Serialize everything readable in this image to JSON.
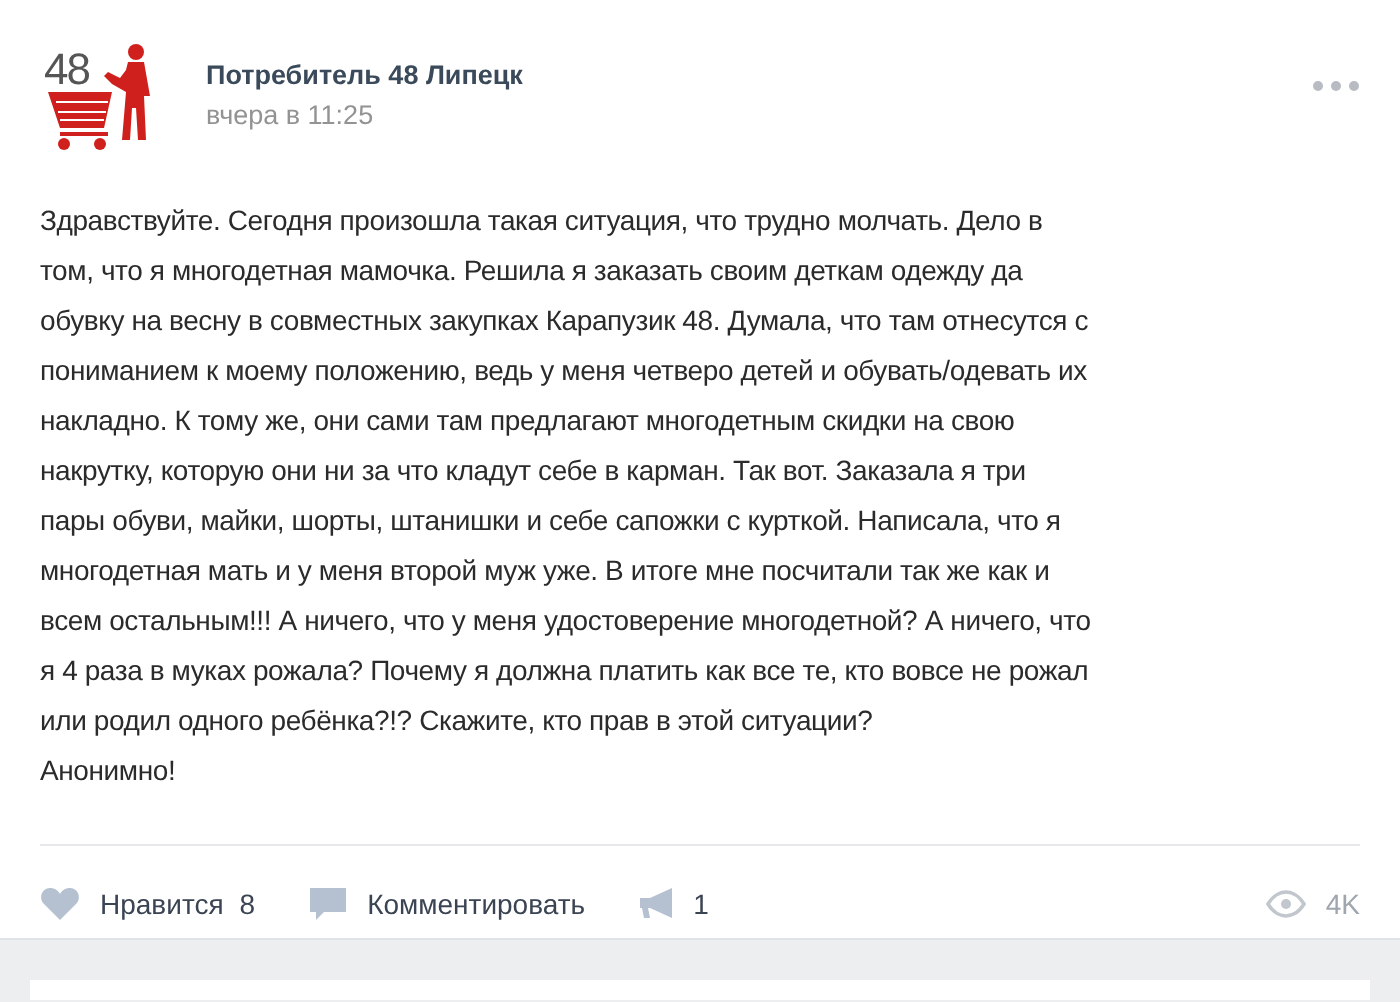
{
  "post": {
    "author": "Потребитель 48 Липецк",
    "time": "вчера в 11:25",
    "avatar_text": "48",
    "body_lines": [
      "Здравствуйте. Сегодня произошла такая ситуация, что трудно молчать. Дело в",
      "том, что я многодетная мамочка. Решила я заказать своим деткам одежду да",
      "обувку на весну в совместных закупках Карапузик 48. Думала, что там отнесутся с",
      "пониманием к моему положению, ведь у меня четверо детей и обувать/одевать их",
      "накладно. К тому же, они сами там предлагают многодетным скидки на свою",
      "накрутку, которую они ни за что кладут себе в карман. Так вот. Заказала я три",
      "пары обуви, майки, шорты, штанишки и себе сапожки с курткой. Написала, что я",
      "многодетная мать и у меня второй муж уже. В итоге мне посчитали так же как и",
      "всем остальным!!! А ничего, что у меня удостоверение многодетной? А ничего, что",
      "я 4 раза в муках рожала? Почему я должна платить как все те, кто вовсе не рожал",
      "или родил одного ребёнка?!? Скажите, кто прав в этой ситуации?"
    ],
    "signature": "Анонимно!",
    "actions": [
      {
        "kind": "like",
        "label": "Нравится",
        "count": "8"
      },
      {
        "kind": "comment",
        "label": "Комментировать"
      },
      {
        "kind": "share",
        "count": "1"
      }
    ],
    "views": "4K"
  }
}
